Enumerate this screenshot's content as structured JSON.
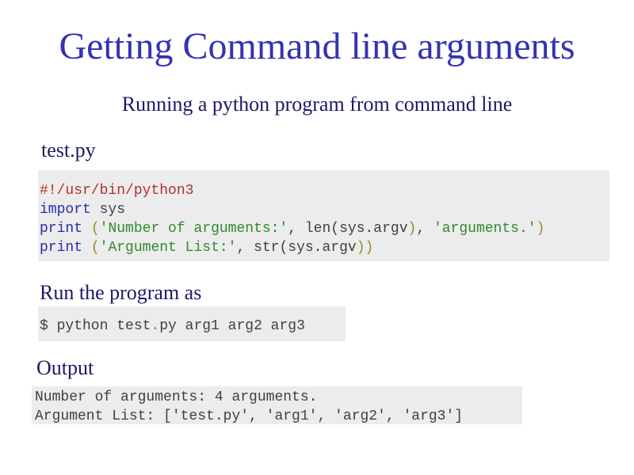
{
  "slide": {
    "title": "Getting Command line arguments",
    "subtitle": "Running a python program from command line",
    "file_heading": "test.py",
    "run_heading": "Run the program as",
    "output_heading": "Output"
  },
  "code": {
    "line1": {
      "comment": "#!/usr/bin/python3"
    },
    "line2": {
      "keyword": "import",
      "rest": " sys"
    },
    "line3": {
      "keyword": "print",
      "space": " ",
      "open_paren": "(",
      "string1": "'Number of arguments:'",
      "mid": ", len(sys.argv",
      "close_inner": ")",
      "comma": ", ",
      "string2": "'arguments.'",
      "close_paren": ")"
    },
    "line4": {
      "keyword": "print",
      "space": " ",
      "open_paren": "(",
      "string1": "'Argument List:'",
      "mid": ", str(sys.argv",
      "close_paren": "))"
    }
  },
  "run_command": {
    "before_dot": "$ python test",
    "dot": ".",
    "after_dot": "py arg1 arg2 arg3"
  },
  "output": {
    "line1": "Number of arguments: 4 arguments.",
    "line2": "Argument List: ['test.py', 'arg1', 'arg2', 'arg3']"
  },
  "colors": {
    "title": "#3333b2",
    "heading": "#1a1a66",
    "code_background": "#ececec",
    "comment": "#b03030",
    "keyword": "#2a2ab2",
    "string": "#2e8b2e",
    "paren": "#9a8a2a"
  }
}
